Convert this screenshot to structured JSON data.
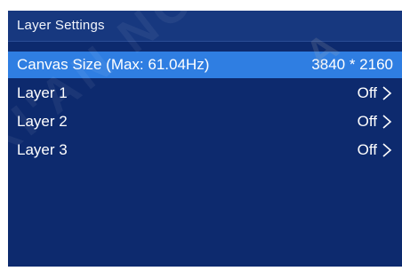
{
  "title": "Layer Settings",
  "items": [
    {
      "label": "Canvas Size (Max: 61.04Hz)",
      "value": "3840 * 2160",
      "selected": true,
      "chevron": false
    },
    {
      "label": "Layer 1",
      "value": "Off",
      "selected": false,
      "chevron": true
    },
    {
      "label": "Layer 2",
      "value": "Off",
      "selected": false,
      "chevron": true
    },
    {
      "label": "Layer 3",
      "value": "Off",
      "selected": false,
      "chevron": true
    }
  ],
  "colors": {
    "background": "#0d2a6e",
    "title_bar": "#17387f",
    "selection": "#2f7ee2",
    "text": "#ffffff"
  },
  "watermark": "NOVASTAR"
}
